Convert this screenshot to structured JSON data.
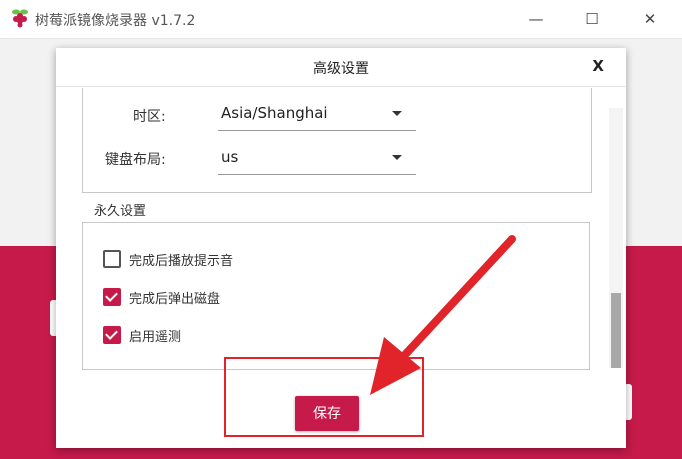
{
  "window": {
    "title": "树莓派镜像烧录器 v1.7.2",
    "minimize": "—",
    "maximize": "☐",
    "close": "✕"
  },
  "dialog": {
    "title": "高级设置",
    "close": "X",
    "timezone": {
      "label": "时区:",
      "value": "Asia/Shanghai"
    },
    "keyboard": {
      "label": "键盘布局:",
      "value": "us"
    },
    "persistent_section": "永久设置",
    "options": [
      {
        "label": "完成后播放提示音",
        "checked": false
      },
      {
        "label": "完成后弹出磁盘",
        "checked": true
      },
      {
        "label": "启用遥测",
        "checked": true
      }
    ],
    "save_label": "保存"
  },
  "colors": {
    "accent": "#c51a4a",
    "annotation": "#e0242a"
  },
  "icons": {
    "app": "raspberry-icon"
  }
}
